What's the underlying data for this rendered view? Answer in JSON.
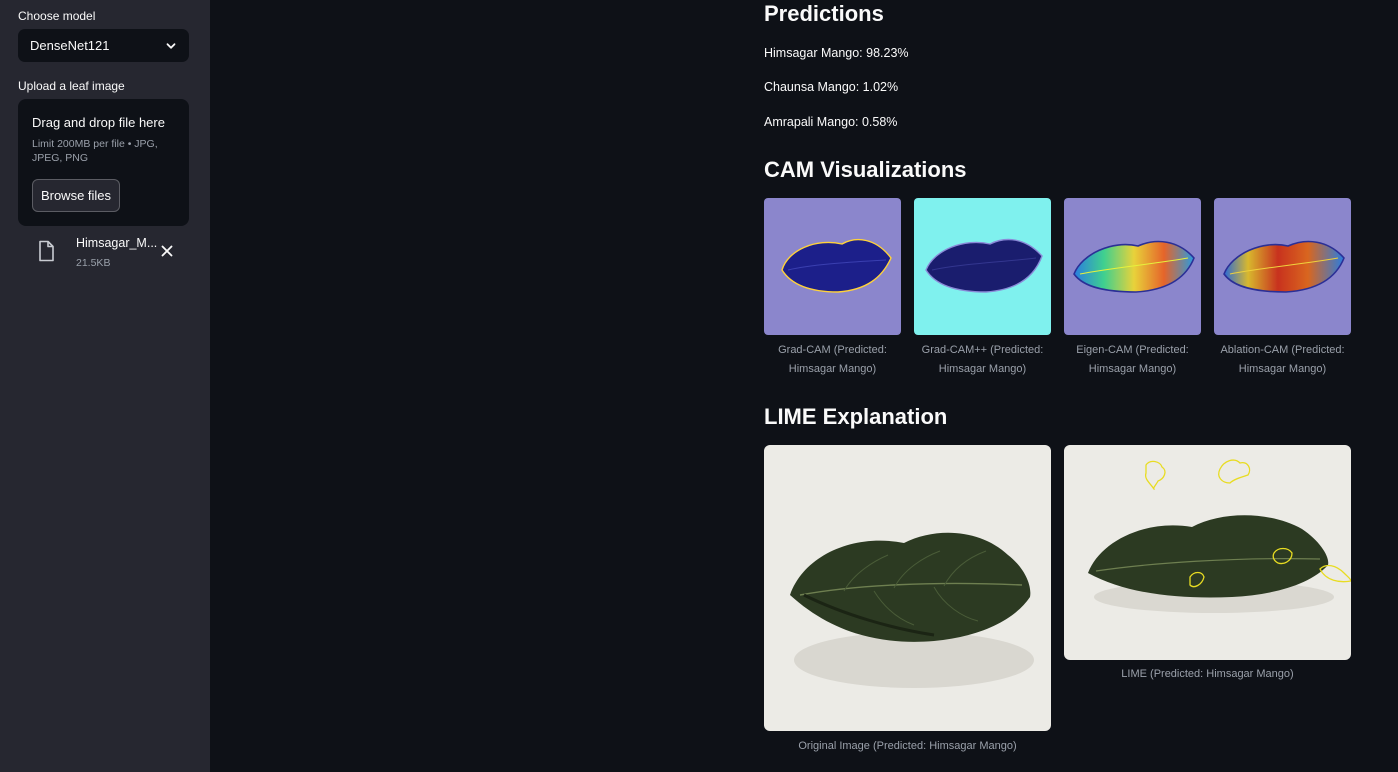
{
  "sidebar": {
    "model_label": "Choose model",
    "model_selected": "DenseNet121",
    "upload_label": "Upload a leaf image",
    "uploader": {
      "title": "Drag and drop file here",
      "limit": "Limit 200MB per file • JPG, JPEG, PNG",
      "browse_label": "Browse files"
    },
    "file": {
      "name": "Himsagar_M...",
      "size": "21.5KB"
    }
  },
  "main": {
    "predictions": {
      "heading": "Predictions",
      "items": [
        "Himsagar Mango: 98.23%",
        "Chaunsa Mango: 1.02%",
        "Amrapali Mango: 0.58%"
      ]
    },
    "cam": {
      "heading": "CAM Visualizations",
      "images": [
        {
          "caption": "Grad-CAM (Predicted: Himsagar Mango)"
        },
        {
          "caption": "Grad-CAM++ (Predicted: Himsagar Mango)"
        },
        {
          "caption": "Eigen-CAM (Predicted: Himsagar Mango)"
        },
        {
          "caption": "Ablation-CAM (Predicted: Himsagar Mango)"
        }
      ]
    },
    "lime": {
      "heading": "LIME Explanation",
      "original_caption": "Original Image (Predicted: Himsagar Mango)",
      "lime_caption": "LIME (Predicted: Himsagar Mango)"
    }
  },
  "colors": {
    "app_bg": "#0e1117",
    "sidebar_bg": "#262730",
    "text": "#fafafa",
    "muted_text": "#9aa0aa"
  },
  "icons": [
    "chevron-down-icon",
    "file-icon",
    "close-icon"
  ]
}
